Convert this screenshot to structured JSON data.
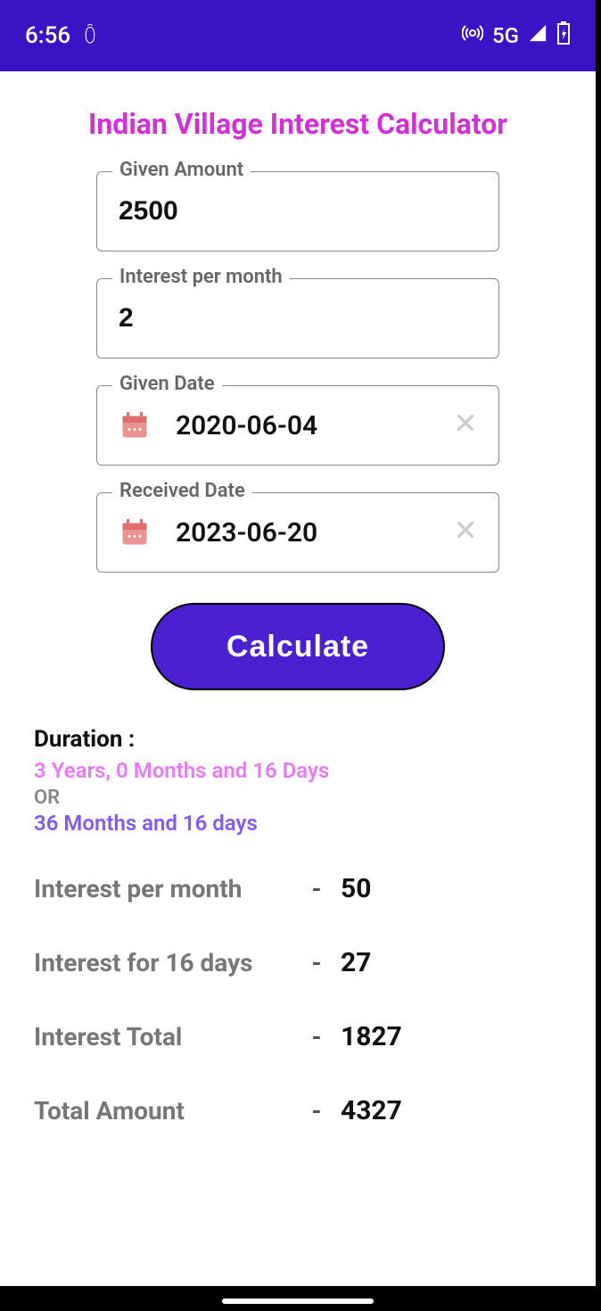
{
  "status": {
    "time": "6:56",
    "network": "5G"
  },
  "title": "Indian Village Interest Calculator",
  "fields": {
    "amount": {
      "label": "Given Amount",
      "value": "2500"
    },
    "interest": {
      "label": "Interest per month",
      "value": "2"
    },
    "given_date": {
      "label": "Given Date",
      "value": "2020-06-04"
    },
    "received_date": {
      "label": "Received Date",
      "value": "2023-06-20"
    }
  },
  "calculate_label": "Calculate",
  "results": {
    "duration_label": "Duration :",
    "duration_line1": "3  Years,   0  Months and 16   Days",
    "duration_or": "OR",
    "duration_line2": "36   Months and 16   days",
    "rows": [
      {
        "label": "Interest per month",
        "value": "50"
      },
      {
        "label": "Interest for 16 days",
        "value": "27"
      },
      {
        "label": "Interest Total",
        "value": "1827"
      },
      {
        "label": "Total Amount",
        "value": "4327"
      }
    ]
  }
}
